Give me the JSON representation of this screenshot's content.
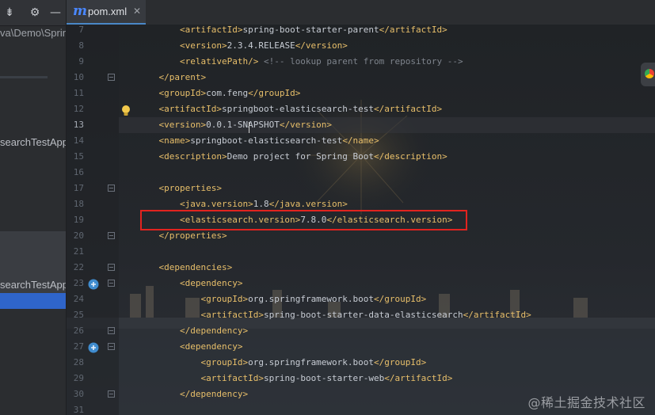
{
  "sidebar": {
    "toolbar": {
      "collapse_icon": "collapse-all-icon",
      "settings_icon": "gear-icon",
      "hide_icon": "minimize-icon"
    },
    "path_fragment": "va\\Demo\\Spring",
    "items": [
      {
        "label": "searchTestApplication"
      },
      {
        "label": "searchTestApplication"
      }
    ]
  },
  "tab": {
    "icon_letter": "m",
    "file_name": "pom.xml",
    "close_glyph": "✕"
  },
  "editor": {
    "current_line": 13,
    "lines": [
      {
        "n": "7",
        "indent": "        ",
        "parts": [
          [
            "tg",
            "<artifactId>"
          ],
          [
            "tx",
            "spring-boot-starter-parent"
          ],
          [
            "tg",
            "</artifactId>"
          ]
        ]
      },
      {
        "n": "8",
        "indent": "        ",
        "parts": [
          [
            "tg",
            "<version>"
          ],
          [
            "tx",
            "2.3.4.RELEASE"
          ],
          [
            "tg",
            "</version>"
          ]
        ]
      },
      {
        "n": "9",
        "indent": "        ",
        "parts": [
          [
            "tg",
            "<relativePath/>"
          ],
          [
            "tx",
            " "
          ],
          [
            "cm",
            "<!-- lookup parent from repository -->"
          ]
        ]
      },
      {
        "n": "10",
        "indent": "    ",
        "parts": [
          [
            "tg",
            "</parent>"
          ]
        ]
      },
      {
        "n": "11",
        "indent": "    ",
        "parts": [
          [
            "tg",
            "<groupId>"
          ],
          [
            "tx",
            "com.feng"
          ],
          [
            "tg",
            "</groupId>"
          ]
        ]
      },
      {
        "n": "12",
        "indent": "    ",
        "parts": [
          [
            "tg",
            "<artifactId>"
          ],
          [
            "tx",
            "springboot-elasticsearch-test"
          ],
          [
            "tg",
            "</artifactId>"
          ]
        ]
      },
      {
        "n": "13",
        "indent": "    ",
        "parts": [
          [
            "tg",
            "<version>"
          ],
          [
            "tx",
            "0.0.1-SNAPSHOT"
          ],
          [
            "tg",
            "</version>"
          ]
        ]
      },
      {
        "n": "14",
        "indent": "    ",
        "parts": [
          [
            "tg",
            "<name>"
          ],
          [
            "tx",
            "springboot-elasticsearch-test"
          ],
          [
            "tg",
            "</name>"
          ]
        ]
      },
      {
        "n": "15",
        "indent": "    ",
        "parts": [
          [
            "tg",
            "<description>"
          ],
          [
            "tx",
            "Demo project for Spring Boot"
          ],
          [
            "tg",
            "</description>"
          ]
        ]
      },
      {
        "n": "16",
        "indent": "",
        "parts": []
      },
      {
        "n": "17",
        "indent": "    ",
        "parts": [
          [
            "tg",
            "<properties>"
          ]
        ]
      },
      {
        "n": "18",
        "indent": "        ",
        "parts": [
          [
            "tg",
            "<java.version>"
          ],
          [
            "tx",
            "1.8"
          ],
          [
            "tg",
            "</java.version>"
          ]
        ]
      },
      {
        "n": "19",
        "indent": "        ",
        "parts": [
          [
            "tg",
            "<elasticsearch.version>"
          ],
          [
            "tx",
            "7.8.0"
          ],
          [
            "tg",
            "</elasticsearch.version>"
          ]
        ]
      },
      {
        "n": "20",
        "indent": "    ",
        "parts": [
          [
            "tg",
            "</properties>"
          ]
        ]
      },
      {
        "n": "21",
        "indent": "",
        "parts": []
      },
      {
        "n": "22",
        "indent": "    ",
        "parts": [
          [
            "tg",
            "<dependencies>"
          ]
        ]
      },
      {
        "n": "23",
        "indent": "        ",
        "parts": [
          [
            "tg",
            "<dependency>"
          ]
        ]
      },
      {
        "n": "24",
        "indent": "            ",
        "parts": [
          [
            "tg",
            "<groupId>"
          ],
          [
            "tx",
            "org.springframework.boot"
          ],
          [
            "tg",
            "</groupId>"
          ]
        ]
      },
      {
        "n": "25",
        "indent": "            ",
        "parts": [
          [
            "tg",
            "<artifactId>"
          ],
          [
            "tx",
            "spring-boot-starter-data-elasticsearch"
          ],
          [
            "tg",
            "</artifactId>"
          ]
        ]
      },
      {
        "n": "26",
        "indent": "        ",
        "parts": [
          [
            "tg",
            "</dependency>"
          ]
        ]
      },
      {
        "n": "27",
        "indent": "        ",
        "parts": [
          [
            "tg",
            "<dependency>"
          ]
        ]
      },
      {
        "n": "28",
        "indent": "            ",
        "parts": [
          [
            "tg",
            "<groupId>"
          ],
          [
            "tx",
            "org.springframework.boot"
          ],
          [
            "tg",
            "</groupId>"
          ]
        ]
      },
      {
        "n": "29",
        "indent": "            ",
        "parts": [
          [
            "tg",
            "<artifactId>"
          ],
          [
            "tx",
            "spring-boot-starter-web"
          ],
          [
            "tg",
            "</artifactId>"
          ]
        ]
      },
      {
        "n": "30",
        "indent": "        ",
        "parts": [
          [
            "tg",
            "</dependency>"
          ]
        ]
      },
      {
        "n": "31",
        "indent": "",
        "parts": []
      }
    ],
    "fold_lines": [
      "10",
      "17",
      "20",
      "22",
      "23",
      "26",
      "27",
      "30"
    ],
    "gutter_icons": [
      {
        "line": "12",
        "icon": "lightbulb-icon"
      },
      {
        "line": "23",
        "icon": "maven-dependency-icon"
      },
      {
        "line": "27",
        "icon": "maven-dependency-icon"
      }
    ]
  },
  "annotation": {
    "highlight_line": "19",
    "color": "#e1231f"
  },
  "watermark": "@稀土掘金技术社区"
}
